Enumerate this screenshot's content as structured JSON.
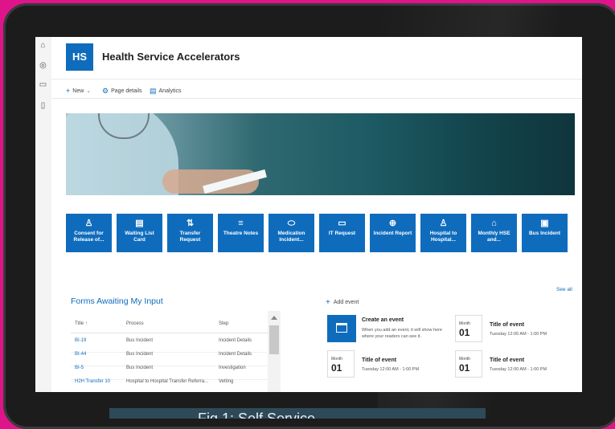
{
  "site": {
    "logo_text": "HS",
    "title": "Health Service Accelerators"
  },
  "commands": {
    "new": "New",
    "page_details": "Page details",
    "analytics": "Analytics"
  },
  "tiles": [
    {
      "label": "Consent for Release of...",
      "icon": "person-icon"
    },
    {
      "label": "Waiting List Card",
      "icon": "document-icon"
    },
    {
      "label": "Transfer Request",
      "icon": "sort-arrows-icon"
    },
    {
      "label": "Theatre Notes",
      "icon": "notes-icon"
    },
    {
      "label": "Medication Incident...",
      "icon": "pill-icon"
    },
    {
      "label": "IT Request",
      "icon": "keyboard-icon"
    },
    {
      "label": "Incident Report",
      "icon": "globe-icon"
    },
    {
      "label": "Hospital to Hospital...",
      "icon": "person-icon"
    },
    {
      "label": "Monthly HSE and...",
      "icon": "home-icon"
    },
    {
      "label": "Bus Incident",
      "icon": "bus-icon"
    }
  ],
  "forms": {
    "title": "Forms Awaiting My Input",
    "headers": {
      "title": "Title ↑",
      "process": "Process",
      "step": "Step"
    },
    "rows": [
      {
        "title": "BI-19",
        "process": "Bus Incident",
        "step": "Incident Details"
      },
      {
        "title": "BI-44",
        "process": "Bus Incident",
        "step": "Incident Details"
      },
      {
        "title": "BI-5",
        "process": "Bus Incident",
        "step": "Investigation"
      },
      {
        "title": "H2H Transfer 10",
        "process": "Hospital to Hospital Transfer Referra...",
        "step": "Vetting"
      }
    ]
  },
  "events": {
    "see_all": "See all",
    "add_event": "Add event",
    "create": {
      "title": "Create an event",
      "desc": "When you add an event, it will show here where your readers can see it."
    },
    "items": [
      {
        "month": "Month",
        "day": "01",
        "title": "Title of event",
        "time": "Tuesday 12:00 AM - 1:00 PM"
      },
      {
        "month": "Month",
        "day": "01",
        "title": "Title of event",
        "time": "Tuesday 12:00 AM - 1:00 PM"
      },
      {
        "month": "Month",
        "day": "01",
        "title": "Title of event",
        "time": "Tuesday 12:00 AM - 1:00 PM"
      }
    ]
  },
  "caption": "Fig 1: Self Service",
  "colors": {
    "brand": "#0f6cbd",
    "frame": "#e0148a"
  }
}
